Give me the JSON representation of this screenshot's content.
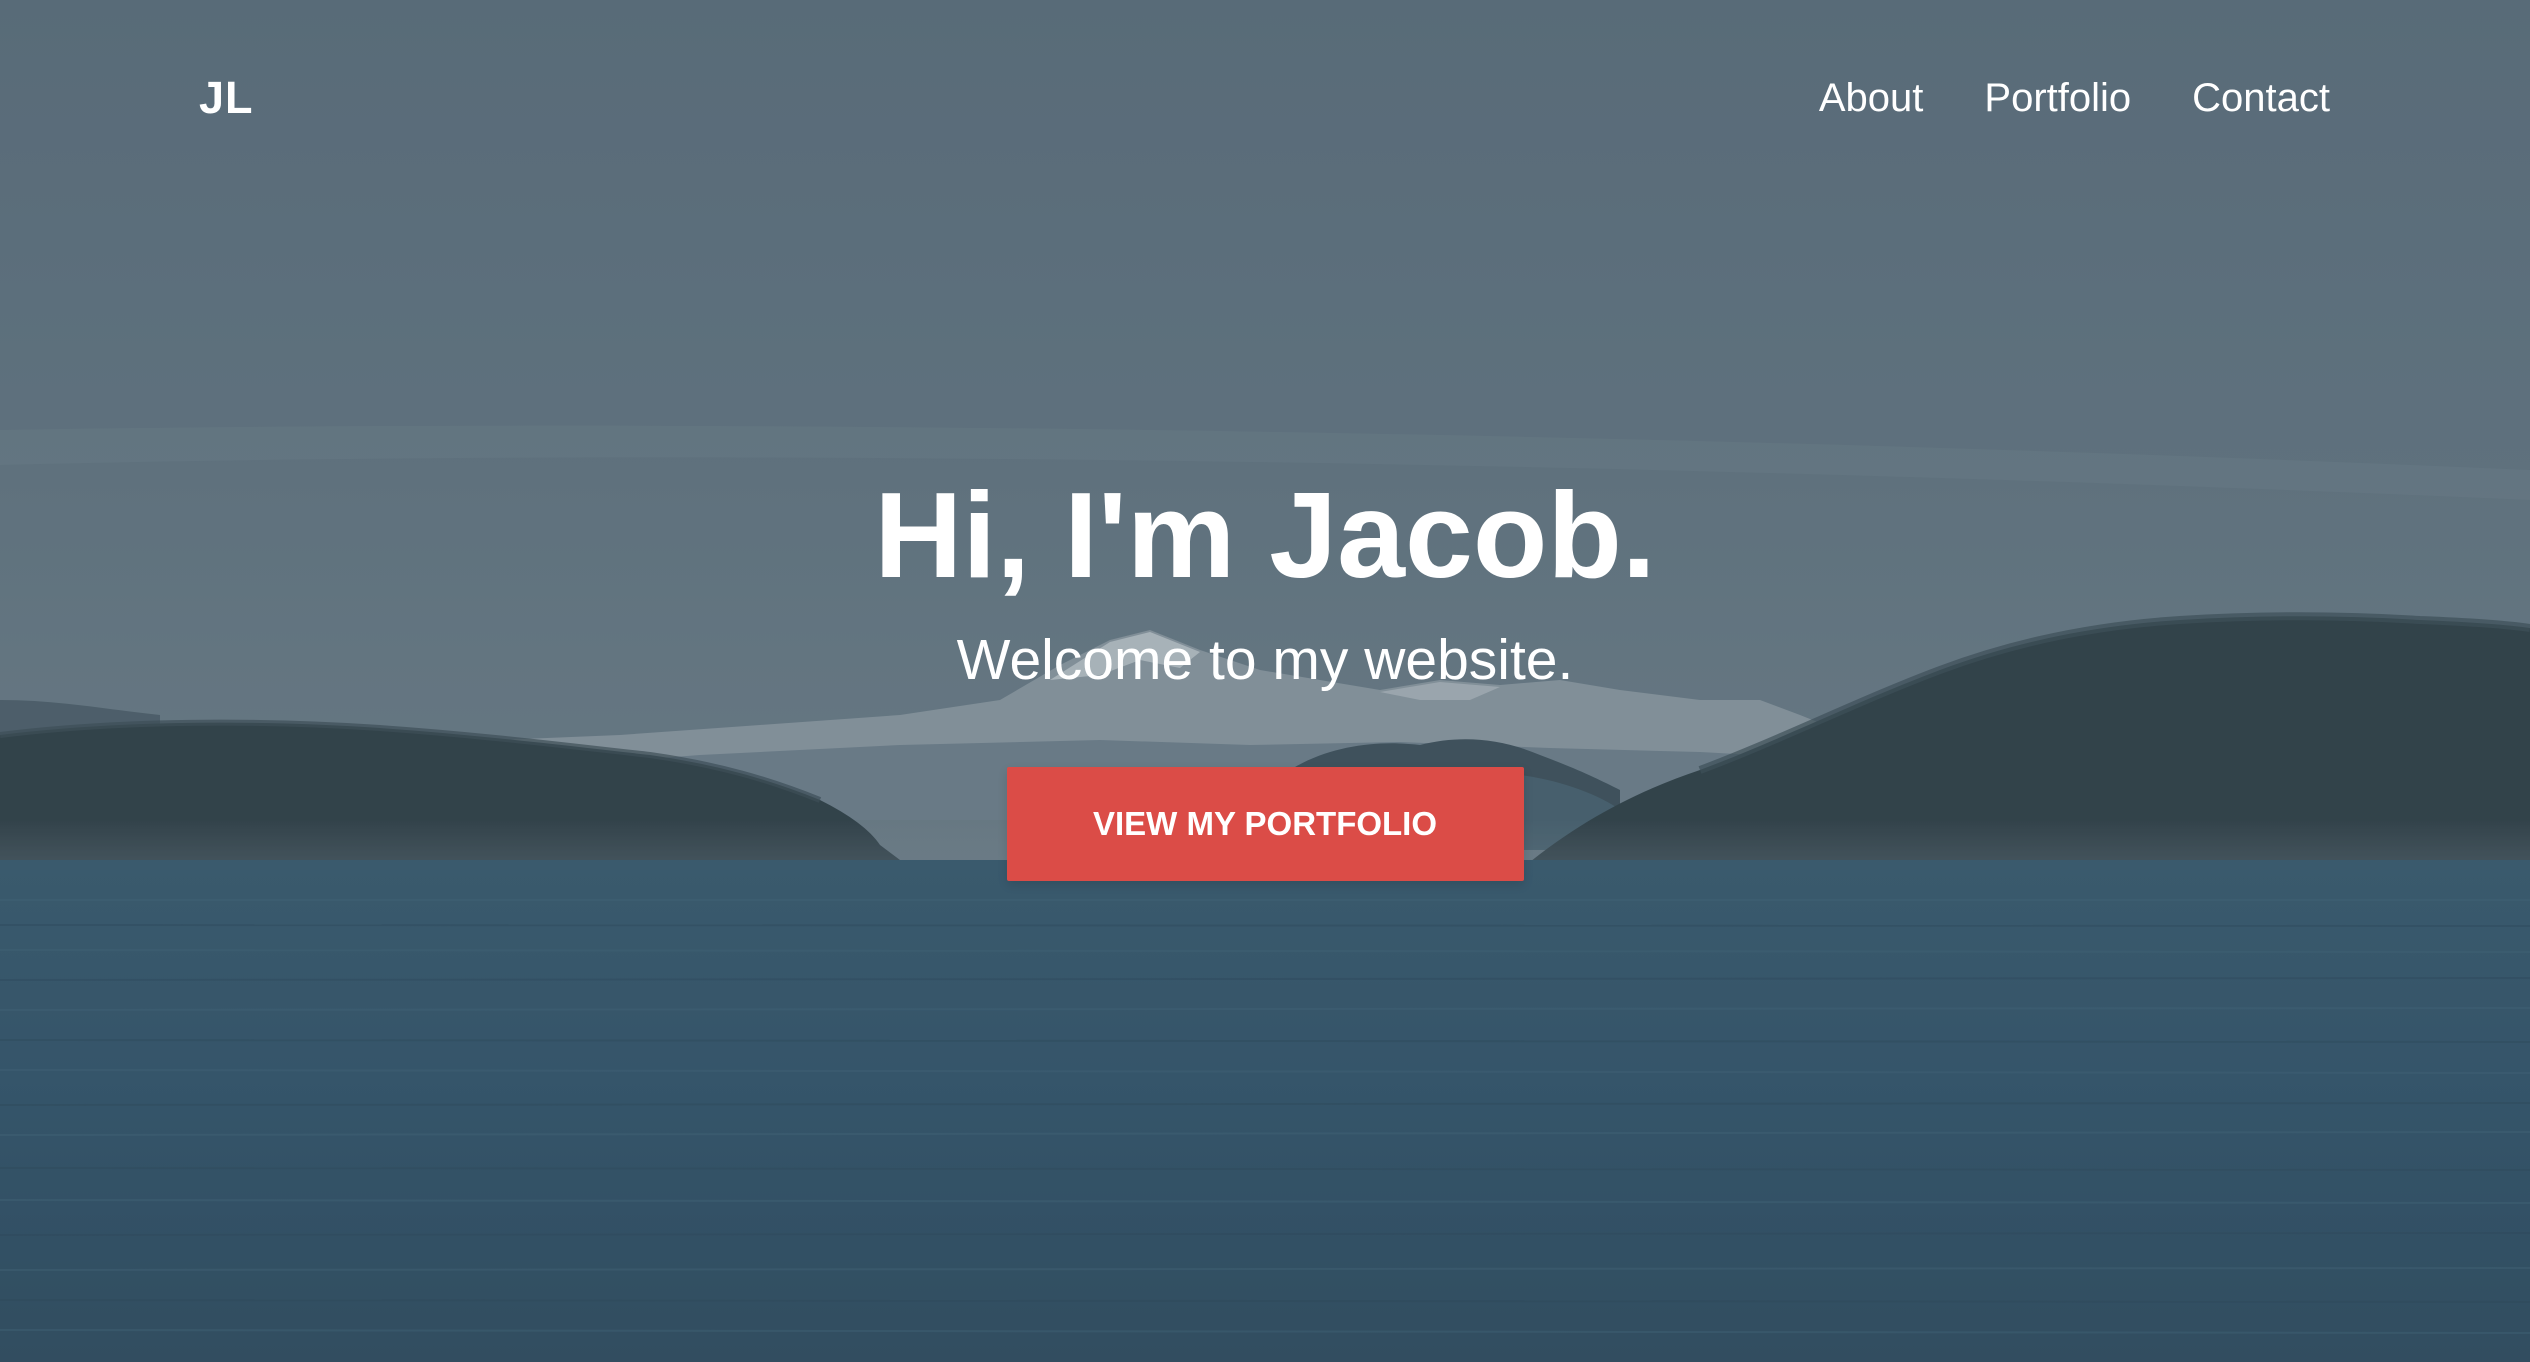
{
  "header": {
    "logo": "JL",
    "nav_items": [
      {
        "label": "About"
      },
      {
        "label": "Portfolio"
      },
      {
        "label": "Contact"
      }
    ]
  },
  "hero": {
    "title": "Hi, I'm Jacob.",
    "subtitle": "Welcome to my website.",
    "cta_label": "VIEW MY PORTFOLIO"
  },
  "colors": {
    "accent": "#db4c47",
    "text": "#ffffff",
    "sky": "#5d707e",
    "water": "#2f5268",
    "forest": "#2d3d43"
  }
}
